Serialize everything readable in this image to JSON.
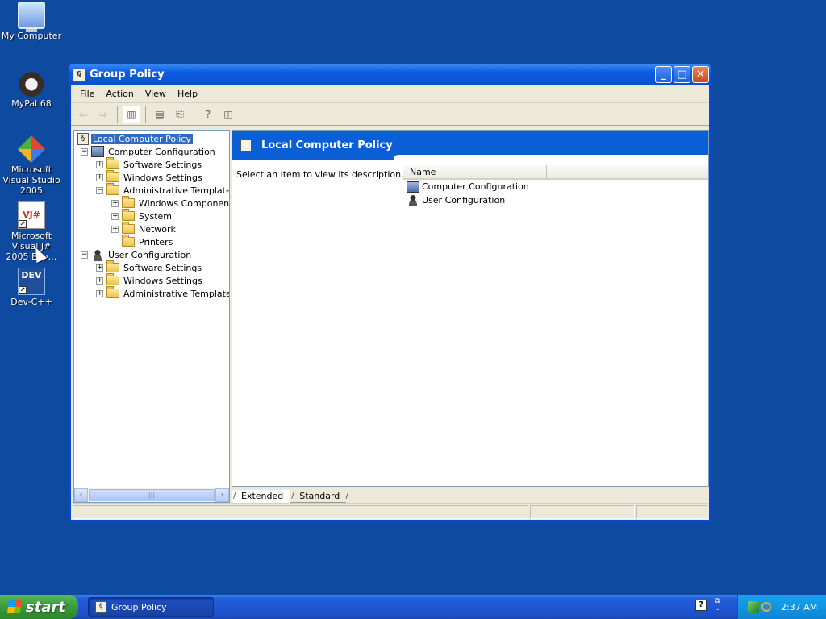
{
  "desktop": {
    "icons": [
      {
        "label": "My Computer"
      },
      {
        "label": "MyPal 68"
      },
      {
        "label": "Microsoft Visual Studio 2005"
      },
      {
        "label": "Microsoft Visual J# 2005 Exp…",
        "badge": "VJ#"
      },
      {
        "label": "Dev-C++",
        "badge": "DEV"
      }
    ]
  },
  "window": {
    "title": "Group Policy",
    "menu": [
      "File",
      "Action",
      "View",
      "Help"
    ],
    "tree": {
      "root": "Local Computer Policy",
      "computer_configuration": "Computer Configuration",
      "cc_children": [
        "Software Settings",
        "Windows Settings",
        "Administrative Templates"
      ],
      "at_children": [
        "Windows Components",
        "System",
        "Network",
        "Printers"
      ],
      "user_configuration": "User Configuration",
      "uc_children": [
        "Software Settings",
        "Windows Settings",
        "Administrative Templates"
      ]
    },
    "right_pane": {
      "header": "Local Computer Policy",
      "description": "Select an item to view its description.",
      "column_name": "Name",
      "items": [
        "Computer Configuration",
        "User Configuration"
      ]
    },
    "tabs": [
      "Extended",
      "Standard"
    ]
  },
  "taskbar": {
    "start_label": "start",
    "task_label": "Group Policy",
    "clock": "2:37 AM"
  },
  "colors": {
    "desktop": "#0e4aa0",
    "titlebar": "#0a5ee0",
    "selection": "#316ac5"
  }
}
